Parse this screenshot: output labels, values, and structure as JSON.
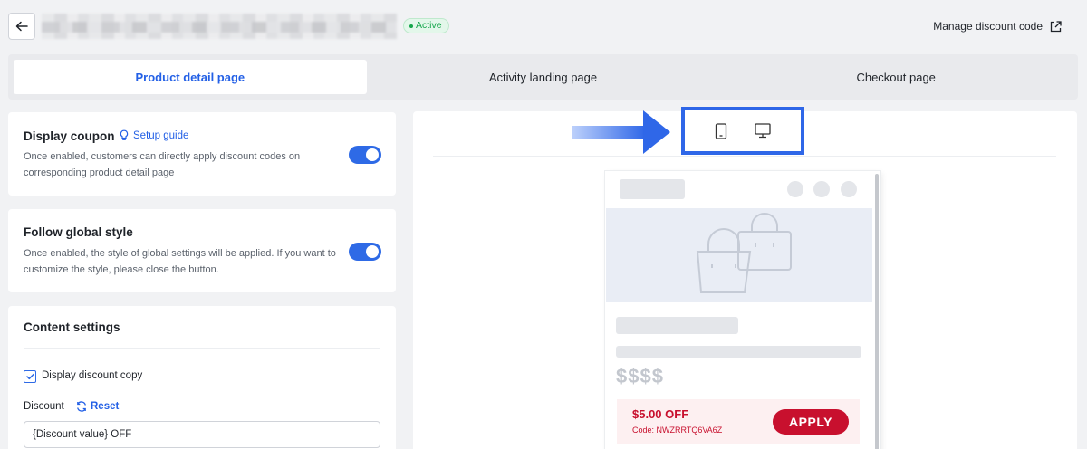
{
  "header": {
    "status_badge": "Active",
    "manage_link": "Manage discount code"
  },
  "tabs": [
    {
      "label": "Product detail page",
      "active": true
    },
    {
      "label": "Activity landing page",
      "active": false
    },
    {
      "label": "Checkout page",
      "active": false
    }
  ],
  "display_coupon": {
    "title": "Display coupon",
    "guide_link": "Setup guide",
    "description": "Once enabled, customers can directly apply discount codes on corresponding product detail page",
    "enabled": true
  },
  "follow_global_style": {
    "title": "Follow global style",
    "description": "Once enabled, the style of global settings will be applied. If you want to customize the style, please close the button.",
    "enabled": true
  },
  "content_settings": {
    "title": "Content settings",
    "display_discount_copy_label": "Display discount copy",
    "display_discount_copy_checked": true,
    "discount_label": "Discount",
    "reset_label": "Reset",
    "discount_value": "{Discount value} OFF"
  },
  "preview": {
    "price_placeholder": "$$$$",
    "coupon_amount": "$5.00 OFF",
    "coupon_code": "Code: NWZRRTQ6VA6Z",
    "apply_label": "APPLY"
  },
  "colors": {
    "accent": "#2360e6",
    "toggle_on": "#2e6ae6",
    "success": "#15a64b",
    "coupon_red": "#c8102e",
    "highlight_border": "#2f67e8"
  },
  "icons": [
    "back-arrow-icon",
    "external-link-icon",
    "bulb-icon",
    "reset-icon",
    "checkbox-check-icon",
    "mobile-icon",
    "desktop-icon",
    "shopping-bag-icon",
    "arrow-right-icon"
  ]
}
